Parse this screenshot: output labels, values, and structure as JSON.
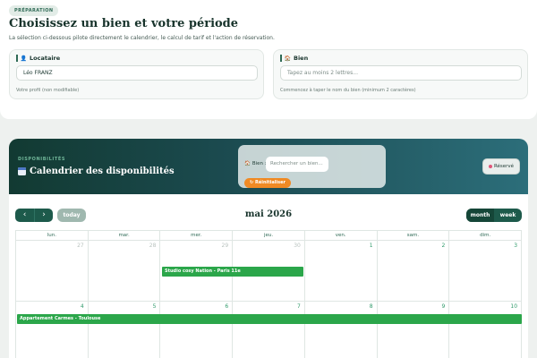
{
  "header": {
    "badge": "PRÉPARATION",
    "title": "Choisissez un bien et votre période",
    "subtitle": "La sélection ci-dessous pilote directement le calendrier, le calcul de tarif et l'action de réservation."
  },
  "tenant_field": {
    "label": "Locataire",
    "value": "Léo FRANZ",
    "hint": "Votre profil (non modifiable)"
  },
  "property_field": {
    "label": "Bien",
    "placeholder": "Tapez au moins 2 lettres...",
    "hint": "Commencez à taper le nom du bien (minimum 2 caractères)"
  },
  "calendar_card": {
    "kicker": "DISPONIBILITÉS",
    "title": "Calendrier des disponibilités",
    "filter_label": "Bien :",
    "filter_placeholder": "Rechercher un bien...",
    "reset_label": "Réinitialiser",
    "reserve_label": "Réservé"
  },
  "toolbar": {
    "prev_icon": "chevron-left",
    "next_icon": "chevron-right",
    "prev_glyph": "‹",
    "next_glyph": "›",
    "today_label": "today",
    "month_title": "mai 2026",
    "views": [
      "month",
      "week"
    ],
    "active_view": "month"
  },
  "calendar": {
    "days_of_week": [
      "lun.",
      "mar.",
      "mer.",
      "jeu.",
      "ven.",
      "sam.",
      "dim."
    ],
    "weeks": [
      {
        "days": [
          "27",
          "28",
          "29",
          "30",
          "1",
          "2",
          "3"
        ],
        "other_month": [
          true,
          true,
          true,
          true,
          false,
          false,
          false
        ]
      },
      {
        "days": [
          "4",
          "5",
          "6",
          "7",
          "8",
          "9",
          "10"
        ],
        "other_month": [
          false,
          false,
          false,
          false,
          false,
          false,
          false
        ]
      }
    ],
    "events": [
      {
        "title": "Studio cosy Nation - Paris 11e",
        "color": "#2ba64a"
      },
      {
        "title": "Appartement Carmes - Toulouse",
        "color": "#2ba64a"
      }
    ]
  },
  "colors": {
    "brand_dark": "#1d5a4b",
    "accent_orange": "#f08a24",
    "event_green": "#2ba64a",
    "reserved_dot": "#e0577a"
  }
}
